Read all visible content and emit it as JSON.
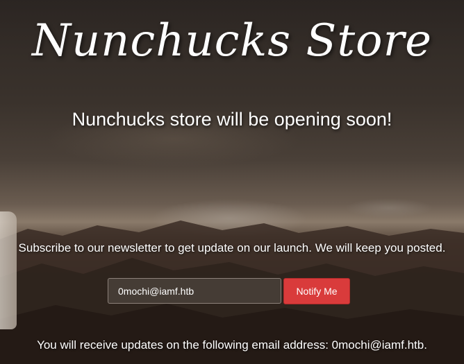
{
  "header": {
    "title": "Nunchucks Store",
    "subtitle": "Nunchucks store will be opening soon!"
  },
  "newsletter": {
    "text": "Subscribe to our newsletter to get update on our launch. We will keep you posted.",
    "email_value": "0mochi@iamf.htb",
    "button_label": "Notify Me",
    "confirmation": "You will receive updates on the following email address: 0mochi@iamf.htb."
  },
  "colors": {
    "button": "#d93b3b",
    "text": "#ffffff"
  }
}
